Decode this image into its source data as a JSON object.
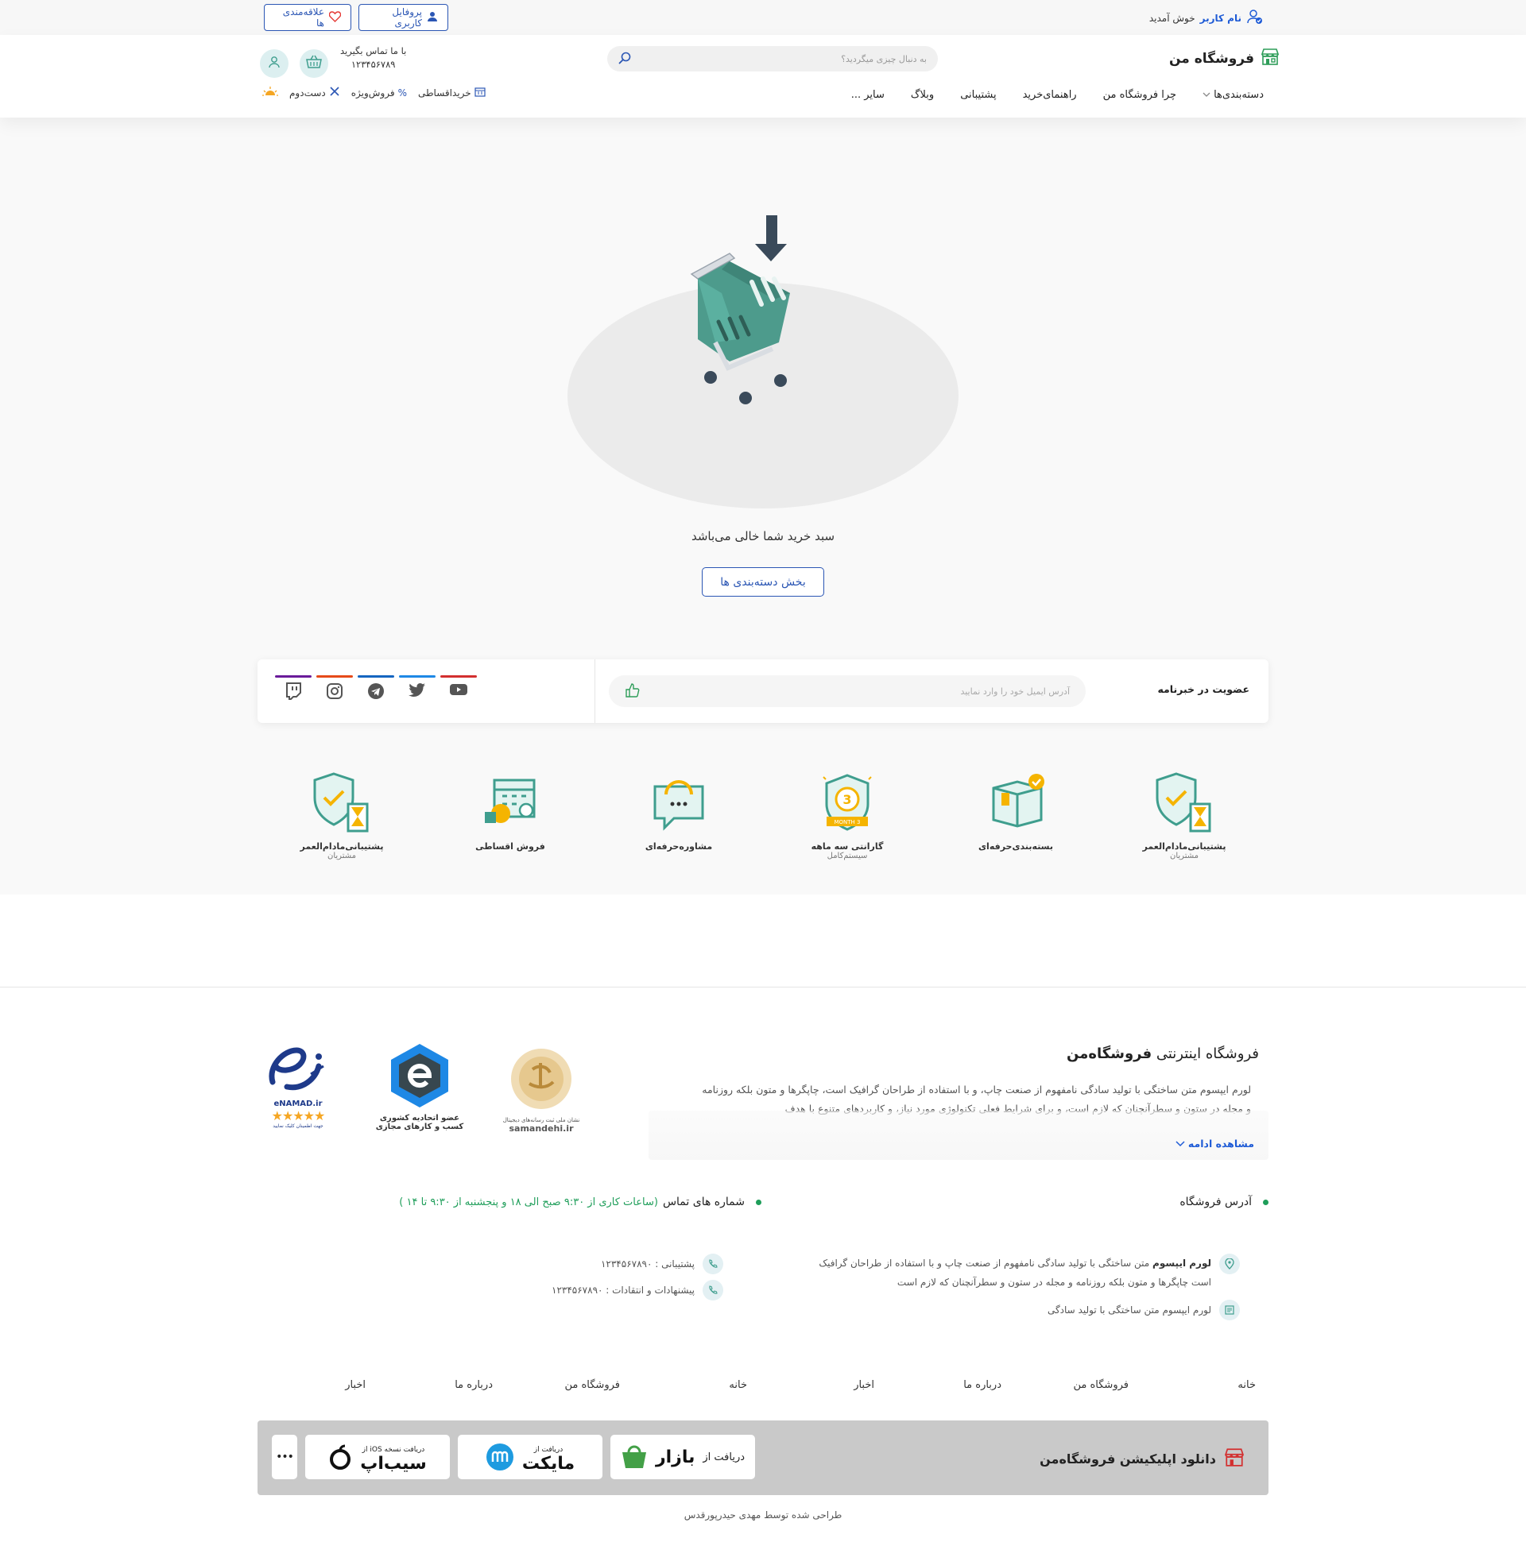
{
  "topbar": {
    "welcome_name": "نام کاربر",
    "welcome_text": "خوش آمدید",
    "profile_label": "پروفایل کاربری",
    "favorites_label": "علاقه‌مندی ها"
  },
  "header": {
    "logo_text": "فروشگاه من",
    "search_placeholder": "به دنبال چیزی میگردید؟",
    "contact_label": "با ما تماس بگیرید",
    "contact_phone": "۱۲۳۴۵۶۷۸۹",
    "nav": [
      "دسته‌بندی‌ها",
      "چرا فروشگاه من",
      "راهنمای‌خرید",
      "پشتیبانی",
      "وبلاگ",
      "سایر ..."
    ],
    "subnav": [
      "خریداقساطی",
      "فروش‌ویژه",
      "دست‌دوم"
    ]
  },
  "cart": {
    "empty_message": "سبد خرید شما خالی می‌باشد",
    "categories_button": "بخش دسته‌بندی ها"
  },
  "newsletter": {
    "title": "عضویت در خبرنامه",
    "placeholder": "آدرس ایمیل خود را وارد نمایید",
    "social": [
      {
        "icon": "youtube-icon",
        "color": "#d32f2f"
      },
      {
        "icon": "twitter-icon",
        "color": "#1e88e5"
      },
      {
        "icon": "telegram-icon",
        "color": "#1565c0"
      },
      {
        "icon": "instagram-icon",
        "color": "#e64a19"
      },
      {
        "icon": "twitch-icon",
        "color": "#6a1b9a"
      }
    ]
  },
  "features": [
    {
      "title": "پشتیبانی‌مادام‌العمر",
      "sub": "مشتریان"
    },
    {
      "title": "بسته‌بندی‌حرفه‌ای",
      "sub": ""
    },
    {
      "title": "گارانتی سه ماهه",
      "sub": "سیستم‌کامل",
      "badge": "3 MONTH"
    },
    {
      "title": "مشاوره‌حرفه‌ای",
      "sub": ""
    },
    {
      "title": "فروش اقساطی",
      "sub": ""
    },
    {
      "title": "پشتیبانی‌مادام‌العمر",
      "sub": "مشتریان"
    }
  ],
  "footer": {
    "title_prefix": "فروشگاه اینترنتی",
    "title_brand": "فروشگاه‌من",
    "description": "لورم ایپسوم متن ساختگی با تولید سادگی نامفهوم از صنعت چاپ، و با استفاده از طراحان گرافیک است، چاپگرها و متون بلکه روزنامه و مجله در ستون و سطرآنچنان که لازم است، و برای شرایط فعلی تکنولوژی مورد نیاز، و کاربردهای متنوع با هدف",
    "more_label": "مشاهده ادامه",
    "badges": {
      "samandehi": "samandehi.ir",
      "samandehi_fa": "نشان ملی ثبت رسانه‌های دیجیتال",
      "union_line1": "عضو اتحادیه کشوری",
      "union_line2": "کسب و کارهای مجازی",
      "enamad": "eNAMAD.ir",
      "enamad_sub": "جهت اطمینان کلیک نمایید",
      "enamad_stars": 5
    },
    "address_heading": "آدرس فروشگاه",
    "phones_heading": "شماره های تماس",
    "phones_hours": "(ساعات کاری از ۹:۳۰ صبح الی ۱۸ و پنجشنبه از ۹:۳۰ تا ۱۴ )",
    "address_bold": "لورم ایپسوم",
    "address_text": "متن ساختگی با تولید سادگی نامفهوم از صنعت چاپ و با استفاده از طراحان گرافیک",
    "address_line2": "است چاپگرها و متون بلکه روزنامه و مجله در ستون و سطرآنچنان که لازم است",
    "postal_text": "لورم ایپسوم متن ساختگی با تولید سادگی",
    "support_phone": "پشتیبانی : ۱۲۳۴۵۶۷۸۹۰",
    "feedback_phone": "پیشنهادات و انتقادات : ۱۲۳۴۵۶۷۸۹۰",
    "links": [
      "خانه",
      "فروشگاه من",
      "درباره ما",
      "اخبار",
      "خانه",
      "فروشگاه من",
      "درباره ما",
      "اخبار"
    ],
    "app_title": "دانلود اپلیکیشن فروشگاه‌من",
    "stores": {
      "bazaar_prefix": "دریافت از",
      "bazaar_name": "بازار",
      "myket_prefix": "دریافت از",
      "myket_name": "مایکت",
      "sibapp_prefix": "دریافت نسخه iOS از",
      "sibapp_name": "سیب‌اپ",
      "more": "•••"
    },
    "credit": "طراحی شده توسط مهدی حیدرپورقدس"
  },
  "colors": {
    "accent": "#2b56b4",
    "link": "#1e5bd6",
    "teal": "#3f9e8e",
    "green_dot": "#1f9e5a"
  }
}
